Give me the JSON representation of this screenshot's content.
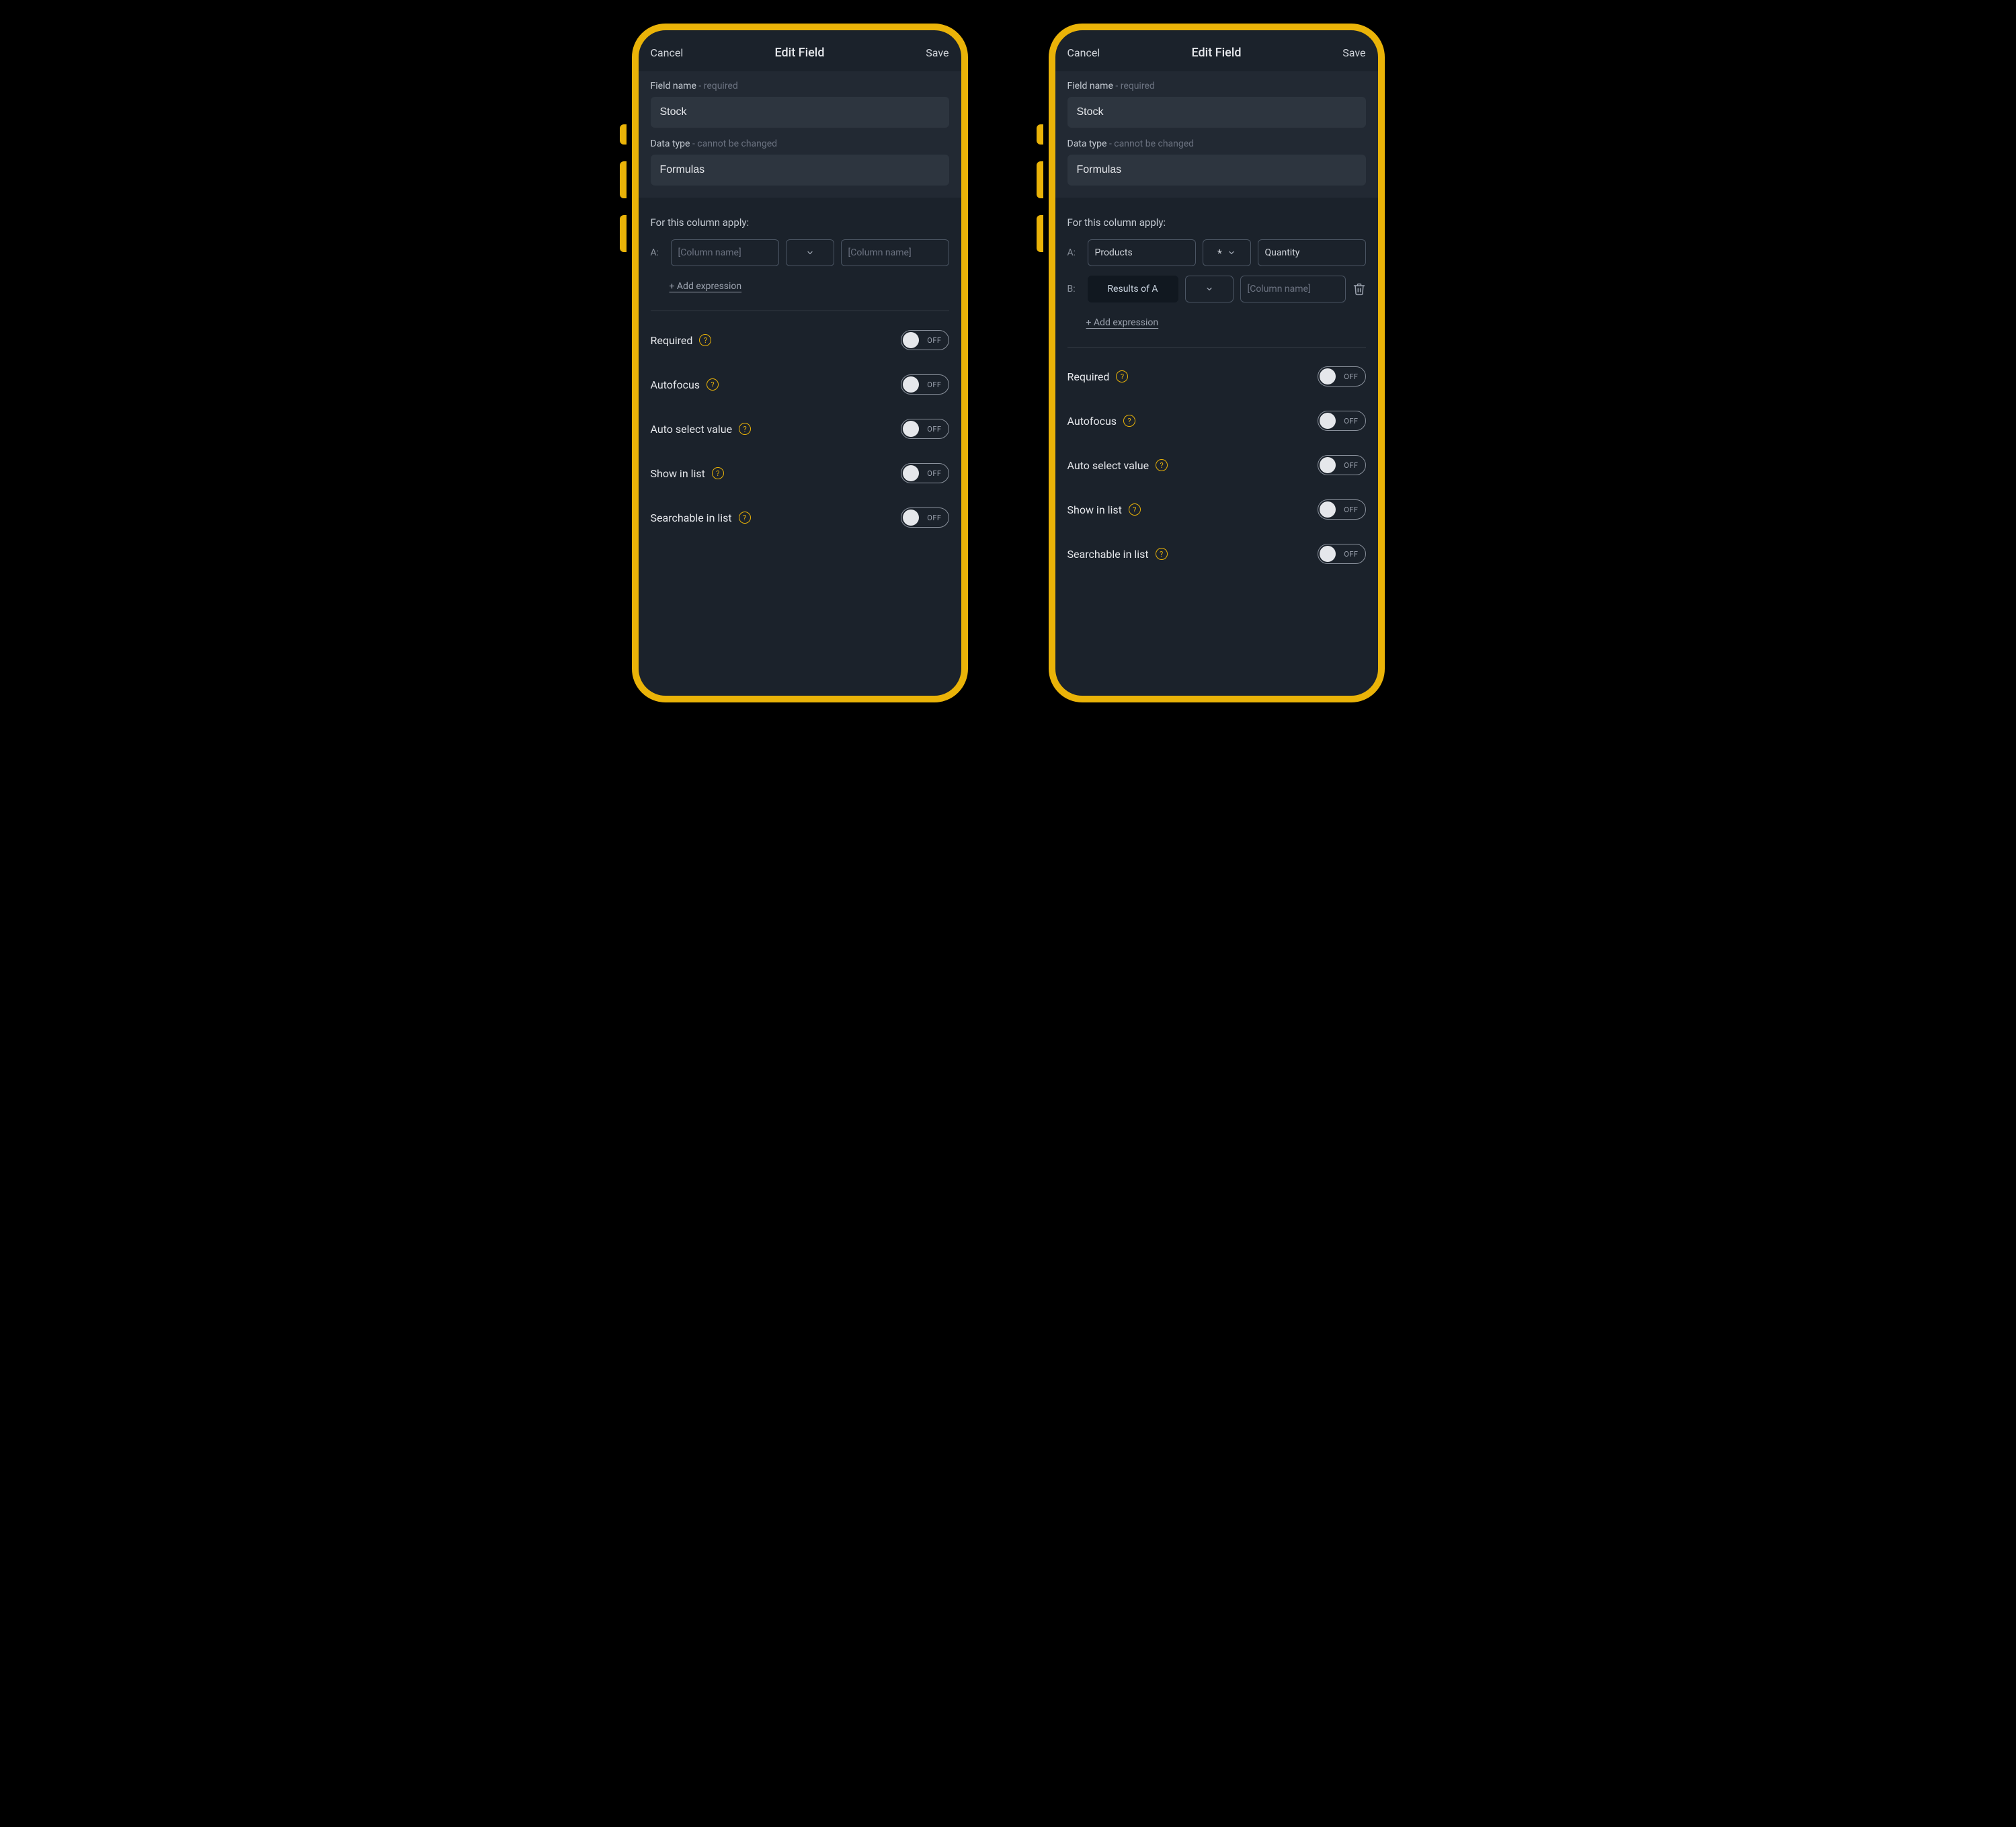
{
  "phones": [
    {
      "header": {
        "cancel": "Cancel",
        "title": "Edit Field",
        "save": "Save"
      },
      "field_name": {
        "label": "Field name",
        "hint": " - required",
        "value": "Stock"
      },
      "data_type": {
        "label": "Data type",
        "hint": " - cannot be changed",
        "value": "Formulas"
      },
      "apply_label": "For this column apply:",
      "expressions": [
        {
          "label": "A:",
          "left": {
            "kind": "input",
            "value": "",
            "placeholder": "[Column name]"
          },
          "op": {
            "kind": "select",
            "value": ""
          },
          "right": {
            "kind": "input",
            "value": "",
            "placeholder": "[Column name]"
          },
          "deletable": false
        }
      ],
      "add_expression": "+ Add expression",
      "toggles": [
        {
          "label": "Required",
          "state": "OFF"
        },
        {
          "label": "Autofocus",
          "state": "OFF"
        },
        {
          "label": "Auto select value",
          "state": "OFF"
        },
        {
          "label": "Show in list",
          "state": "OFF"
        },
        {
          "label": "Searchable in list",
          "state": "OFF"
        }
      ]
    },
    {
      "header": {
        "cancel": "Cancel",
        "title": "Edit Field",
        "save": "Save"
      },
      "field_name": {
        "label": "Field name",
        "hint": " - required",
        "value": "Stock"
      },
      "data_type": {
        "label": "Data type",
        "hint": " - cannot be changed",
        "value": "Formulas"
      },
      "apply_label": "For this column apply:",
      "expressions": [
        {
          "label": "A:",
          "left": {
            "kind": "input",
            "value": "Products",
            "placeholder": "[Column name]"
          },
          "op": {
            "kind": "select",
            "value": "*"
          },
          "right": {
            "kind": "input",
            "value": "Quantity",
            "placeholder": "[Column name]"
          },
          "deletable": false
        },
        {
          "label": "B:",
          "left": {
            "kind": "static",
            "value": "Results of A"
          },
          "op": {
            "kind": "select",
            "value": ""
          },
          "right": {
            "kind": "input",
            "value": "",
            "placeholder": "[Column name]"
          },
          "deletable": true
        }
      ],
      "add_expression": "+ Add expression",
      "toggles": [
        {
          "label": "Required",
          "state": "OFF"
        },
        {
          "label": "Autofocus",
          "state": "OFF"
        },
        {
          "label": "Auto select value",
          "state": "OFF"
        },
        {
          "label": "Show in list",
          "state": "OFF"
        },
        {
          "label": "Searchable in list",
          "state": "OFF"
        }
      ]
    }
  ]
}
